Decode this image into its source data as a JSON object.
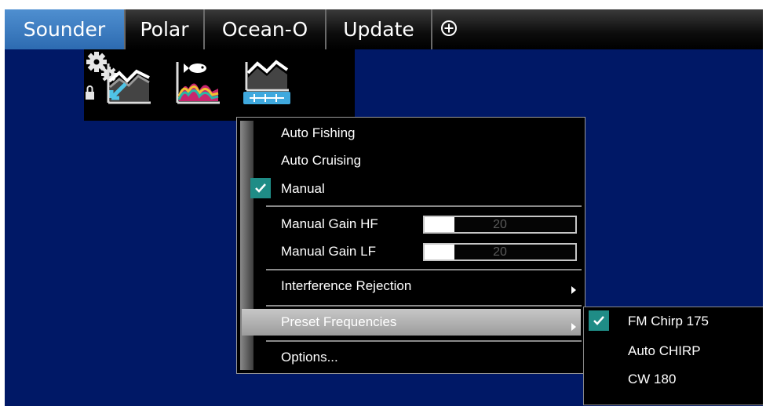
{
  "tabs": [
    {
      "label": "Sounder",
      "active": true
    },
    {
      "label": "Polar"
    },
    {
      "label": "Ocean-O"
    },
    {
      "label": "Update"
    }
  ],
  "add_tab_icon": "circle-plus-icon",
  "toolbar": {
    "icons": [
      "sounder-cursor-icon",
      "fish-echo-icon",
      "manual-gain-icon",
      "settings-gears-lock-icon"
    ]
  },
  "menu": {
    "gain_modes": [
      "Auto Fishing",
      "Auto Cruising",
      "Manual"
    ],
    "selected_gain_mode": "Manual",
    "manual_gain_hf": {
      "label": "Manual Gain HF",
      "value": "20",
      "level": 0.2
    },
    "manual_gain_lf": {
      "label": "Manual Gain LF",
      "value": "20",
      "level": 0.2
    },
    "interference_rejection": "Interference Rejection",
    "preset_frequencies": "Preset Frequencies",
    "options": "Options..."
  },
  "submenu": {
    "items": [
      "FM Chirp 175",
      "Auto CHIRP",
      "CW 180"
    ],
    "selected": "FM Chirp 175"
  },
  "colors": {
    "background": "#001866",
    "active_tab": "#3b7cc2",
    "check": "#1f8c86",
    "highlight": "#b2b2b2"
  }
}
